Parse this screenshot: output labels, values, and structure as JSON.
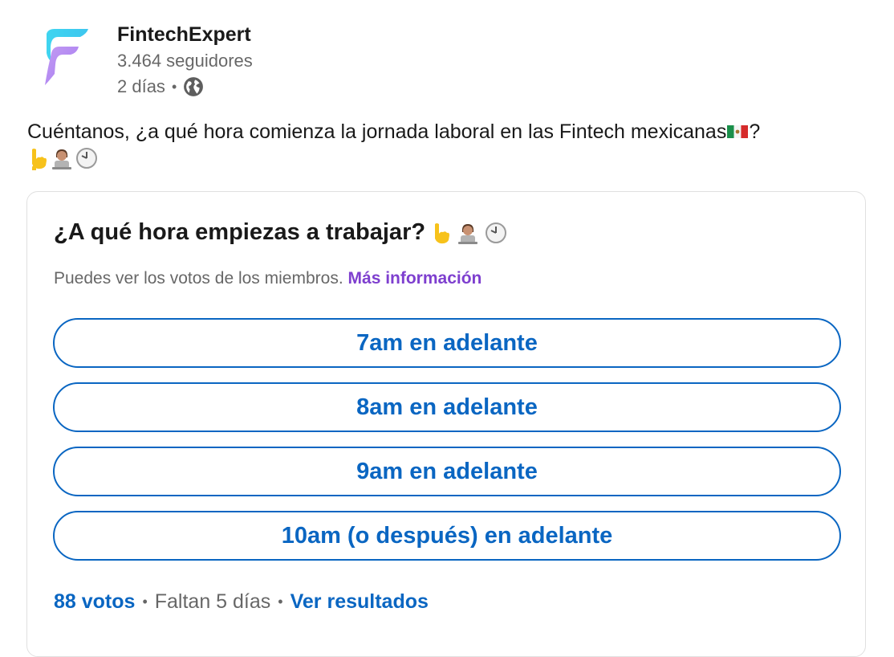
{
  "author": {
    "name": "FintechExpert",
    "followers": "3.464 seguidores",
    "time": "2 días",
    "visibility_icon": "globe-icon"
  },
  "post": {
    "text": "Cuéntanos, ¿a qué hora comienza la jornada laboral en las Fintech mexicanas",
    "text_end": "?",
    "emojis": [
      "point-down-emoji",
      "technologist-emoji",
      "clock-emoji"
    ],
    "flag_icon": "mexico-flag-icon"
  },
  "poll": {
    "question": "¿A qué hora empiezas a trabajar?",
    "note": "Puedes ver los votos de los miembros.",
    "more_info": "Más información",
    "options": [
      "7am en adelante",
      "8am en adelante",
      "9am en adelante",
      "10am (o después) en adelante"
    ],
    "votes": "88 votos",
    "remaining": "Faltan 5 días",
    "view_results": "Ver resultados"
  },
  "colors": {
    "accent": "#0a66c2",
    "link_purple": "#7e3fcf",
    "border": "#e0e0e0"
  }
}
